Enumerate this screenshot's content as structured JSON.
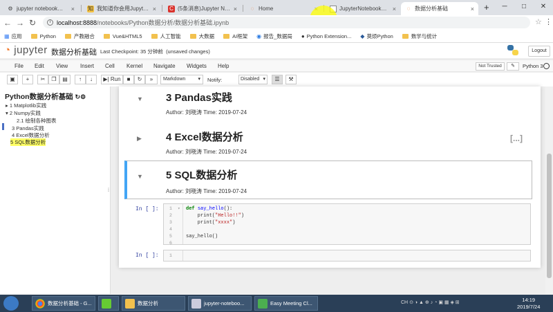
{
  "browser": {
    "tabs": [
      {
        "icon": "settings-icon",
        "title": "jupyter notebook目录的...",
        "active": false
      },
      {
        "icon": "zhihu-icon",
        "title": "我知道你会用Jupyter No...",
        "active": false
      },
      {
        "icon": "csdn-icon",
        "title": "(5条消息)Jupyter Notebo...",
        "active": false
      },
      {
        "icon": "jupyter-icon",
        "title": "Home",
        "active": false
      },
      {
        "icon": "doc-icon",
        "title": "JupyterNotebook操作界...",
        "active": false
      },
      {
        "icon": "jupyter-icon",
        "title": "数据分析基础",
        "active": true
      }
    ],
    "new_tab": "+",
    "url_host": "localhost:8888",
    "url_path": "/notebooks/Python数据分析/数据分析基础.ipynb",
    "bookmarks": [
      "应用",
      "Python",
      "产教融合",
      "Vue&HTML5",
      "人工智能",
      "大数据",
      "AI框架",
      "报告_数据局",
      "Python Extension...",
      "莫烦Python",
      "数学与统计"
    ]
  },
  "jupyter": {
    "logo": "jupyter",
    "notebook_title": "数据分析基础",
    "checkpoint": "Last Checkpoint: 35 分钟前",
    "unsaved": "(unsaved changes)",
    "logout": "Logout",
    "menu": [
      "File",
      "Edit",
      "View",
      "Insert",
      "Cell",
      "Kernel",
      "Navigate",
      "Widgets",
      "Help"
    ],
    "trusted": "Not Trusted",
    "kernel": "Python 3",
    "toolbar": {
      "run_label": "Run",
      "cell_type": "Markdown",
      "notify_label": "Notify:",
      "notify_value": "Disabled"
    }
  },
  "toc": {
    "title": "Python数据分析基础",
    "items": [
      {
        "text": "▸ 1  Matplotlib实践"
      },
      {
        "text": "▾ 2  Numpy实践"
      },
      {
        "text": "2.1  绘制各种图表"
      },
      {
        "text": "3  Pandas实践"
      },
      {
        "text": "4  Excel数据分析"
      },
      {
        "text": "5  SQL数据分析"
      }
    ]
  },
  "cells": [
    {
      "heading": "3  Pandas实践",
      "author": "Author: 刘晓涛 Time: 2019-07-24"
    },
    {
      "heading": "4  Excel数据分析",
      "author": "Author: 刘晓涛 Time: 2019-07-24",
      "collapsed_marker": "[...]"
    },
    {
      "heading": "5  SQL数据分析",
      "author": "Author: 刘晓涛 Time: 2019-07-24"
    }
  ],
  "code_cells": [
    {
      "prompt": "In  [  ]:",
      "line_numbers": [
        "1",
        "2",
        "3",
        "4",
        "5",
        "6"
      ],
      "code": {
        "l1_kw": "def",
        "l1_fn": "say_hello",
        "l1_rest": "():",
        "l2_pre": "    print(",
        "l2_str": "\"Hello!!\"",
        "l2_post": ")",
        "l3_pre": "    print(",
        "l3_str": "\"xxxx\"",
        "l3_post": ")",
        "l5": "say_hello()"
      }
    },
    {
      "prompt": "In  [  ]:",
      "line_numbers": [
        "1"
      ]
    }
  ],
  "taskbar": {
    "tasks": [
      "数据分析基础 - G...",
      "",
      "数据分析",
      "jupyter-noteboo...",
      "Easy Meeting Cl..."
    ],
    "tray_text": "CH",
    "time": "14:19",
    "date": "2019/7/24"
  }
}
